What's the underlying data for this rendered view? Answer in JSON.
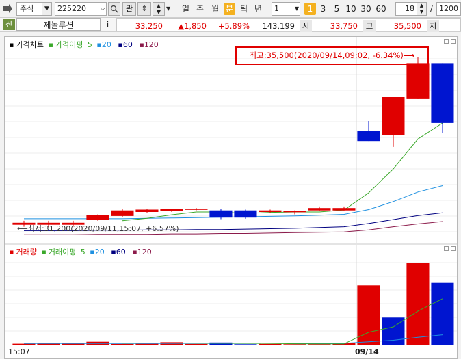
{
  "toolbar": {
    "market_label": "주식",
    "stock_code": "225220",
    "open_label": "관",
    "periods": [
      "일",
      "주",
      "월",
      "분",
      "틱",
      "년"
    ],
    "active_period": "분",
    "interval_value": "1",
    "minute_steps": [
      "1",
      "3",
      "5",
      "10",
      "30",
      "60"
    ],
    "active_step": "1",
    "count_value": "18",
    "slash": "/",
    "total_count": "1200"
  },
  "quote": {
    "credit_badge": "신",
    "stock_name": "제놀루션",
    "info_icon_label": "i",
    "price": "33,250",
    "change": "▲1,850",
    "change_pct": "+5.89%",
    "volume": "143,199",
    "open_label": "시",
    "open_value": "33,750",
    "high_label": "고",
    "high_value": "35,500",
    "low_label": "저"
  },
  "colors": {
    "up": "#e00000",
    "down": "#0015d0",
    "ma5": "#3aa82a",
    "ma20": "#1e90e0",
    "ma60": "#000080",
    "ma120": "#8b1a4a"
  },
  "price_panel": {
    "legend_title": "가격차트",
    "legend_ma_title": "가격이평",
    "ma_periods": [
      "5",
      "20",
      "60",
      "120"
    ],
    "high_annotation": "최고:35,500(2020/09/14,09:02, -6.34%)⟶",
    "low_annotation": "⟵최저:31,200(2020/09/11,15:07, +6.57%)"
  },
  "volume_panel": {
    "legend_title": "거래량",
    "legend_ma_title": "거래이평",
    "ma_periods": [
      "5",
      "20",
      "60",
      "120"
    ]
  },
  "time_axis": {
    "left_label": "15:07",
    "date_label": "09/14"
  },
  "chart_data": {
    "type": "candlestick",
    "title": "",
    "x": [
      "15:07",
      "",
      "",
      "",
      "",
      "",
      "",
      "",
      "",
      "",
      "",
      "",
      "",
      "",
      "09/14",
      "",
      "",
      ""
    ],
    "candles": [
      {
        "open": 31300,
        "close": 31350,
        "high": 31400,
        "low": 31250
      },
      {
        "open": 31300,
        "close": 31350,
        "high": 31400,
        "low": 31250
      },
      {
        "open": 31300,
        "close": 31350,
        "high": 31400,
        "low": 31250
      },
      {
        "open": 31420,
        "close": 31540,
        "high": 31560,
        "low": 31400
      },
      {
        "open": 31520,
        "close": 31660,
        "high": 31690,
        "low": 31500
      },
      {
        "open": 31620,
        "close": 31680,
        "high": 31700,
        "low": 31590
      },
      {
        "open": 31650,
        "close": 31690,
        "high": 31700,
        "low": 31620
      },
      {
        "open": 31680,
        "close": 31700,
        "high": 31720,
        "low": 31660
      },
      {
        "open": 31660,
        "close": 31480,
        "high": 31700,
        "low": 31440
      },
      {
        "open": 31660,
        "close": 31480,
        "high": 31680,
        "low": 31450
      },
      {
        "open": 31620,
        "close": 31660,
        "high": 31680,
        "low": 31600
      },
      {
        "open": 31620,
        "close": 31640,
        "high": 31660,
        "low": 31560
      },
      {
        "open": 31660,
        "close": 31720,
        "high": 31760,
        "low": 31640
      },
      {
        "open": 31660,
        "close": 31720,
        "high": 31760,
        "low": 31640
      },
      {
        "open": 33650,
        "close": 33400,
        "high": 33900,
        "low": 33400
      },
      {
        "open": 33550,
        "close": 34500,
        "high": 34500,
        "low": 33250
      },
      {
        "open": 34450,
        "close": 35350,
        "high": 35500,
        "low": 34450
      },
      {
        "open": 35350,
        "close": 33850,
        "high": 35350,
        "low": 33600
      }
    ],
    "ma5": [
      null,
      null,
      null,
      null,
      31400,
      31460,
      31550,
      31620,
      31620,
      31580,
      31610,
      31620,
      31620,
      31670,
      32100,
      32700,
      33450,
      33850
    ],
    "ma20": [
      31450,
      31450,
      31450,
      31450,
      31450,
      31460,
      31470,
      31480,
      31490,
      31500,
      31510,
      31520,
      31540,
      31560,
      31680,
      31880,
      32120,
      32280
    ],
    "ma60": [
      31150,
      31150,
      31150,
      31160,
      31160,
      31170,
      31170,
      31180,
      31180,
      31190,
      31200,
      31210,
      31230,
      31250,
      31330,
      31430,
      31530,
      31600
    ],
    "ma120": [
      31050,
      31050,
      31050,
      31060,
      31060,
      31060,
      31070,
      31070,
      31080,
      31080,
      31090,
      31100,
      31110,
      31120,
      31170,
      31250,
      31320,
      31380
    ],
    "price_range": [
      30900,
      35700
    ],
    "volume": [
      400,
      500,
      600,
      1200,
      300,
      400,
      1000,
      300,
      900,
      200,
      300,
      200,
      200,
      600,
      24000,
      11000,
      33000,
      25000
    ],
    "volume_up": [
      true,
      true,
      true,
      true,
      true,
      true,
      true,
      true,
      false,
      false,
      true,
      true,
      true,
      true,
      true,
      false,
      true,
      false
    ],
    "vol_ma5": [
      null,
      null,
      null,
      null,
      600,
      680,
      700,
      640,
      580,
      560,
      540,
      400,
      360,
      360,
      5000,
      7200,
      13600,
      18600
    ],
    "vol_ma20": [
      500,
      500,
      500,
      500,
      500,
      510,
      520,
      530,
      540,
      540,
      550,
      560,
      560,
      560,
      1200,
      1800,
      3000,
      4000
    ],
    "volume_range": [
      0,
      36000
    ]
  }
}
